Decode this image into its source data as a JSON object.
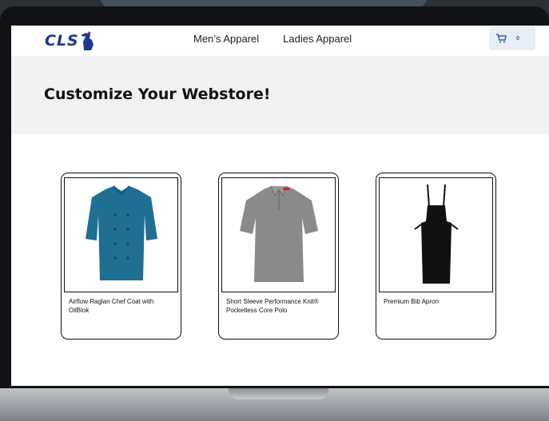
{
  "header": {
    "logo_text": "CLS",
    "nav": [
      "Men’s Apparel",
      "Ladies Apparel"
    ],
    "cart_count": "0"
  },
  "hero": {
    "title": "Customize Your Webstore!"
  },
  "products": [
    {
      "name": "Airflow Raglan Chef Coat with OilBlok",
      "image": "teal-chef-coat",
      "color": "#1f6f93"
    },
    {
      "name": "Short Sleeve Performance Knit® Pocketless Core Polo",
      "image": "gray-polo",
      "color": "#8a8a8a"
    },
    {
      "name": "Premium Bib Apron",
      "image": "black-bib-apron",
      "color": "#111111"
    }
  ],
  "colors": {
    "brand": "#1a3a8f",
    "accent": "#e31b23"
  }
}
